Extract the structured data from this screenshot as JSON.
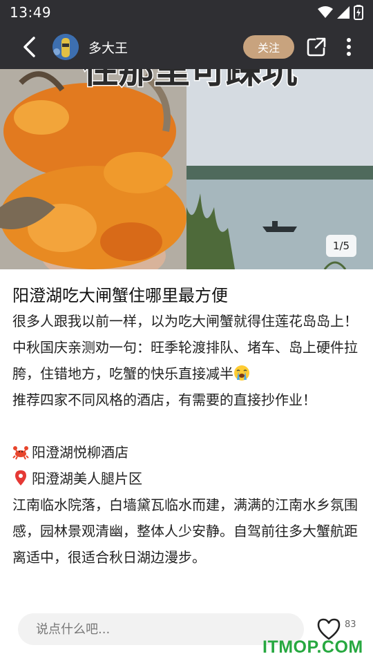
{
  "status_bar": {
    "time": "13:49"
  },
  "header": {
    "author_name": "多大王",
    "follow_label": "关注"
  },
  "carousel": {
    "image_title_text": "住那里可踩坑",
    "counter": "1/5"
  },
  "post": {
    "title": "阳澄湖吃大闸蟹住哪里最方便",
    "paragraphs": [
      "很多人跟我以前一样，以为吃大闸蟹就得住莲花岛岛上！",
      "中秋国庆亲测劝一句：旺季轮渡排队、堵车、岛上硬件拉胯，住错地方，吃蟹的快乐直接减半",
      "推荐四家不同风格的酒店，有需要的直接抄作业！",
      "阳澄湖悦柳酒店",
      "阳澄湖美人腿片区",
      "江南临水院落，白墙黛瓦临水而建，满满的江南水乡氛围感，园林景观清幽，整体人少安静。自驾前往多大蟹航距离适中，很适合秋日湖边漫步。"
    ],
    "icons": {
      "crying": "crying-emoji-icon",
      "crab": "crab-emoji-icon",
      "pin": "location-pin-icon"
    }
  },
  "bottom_bar": {
    "comment_placeholder": "说点什么吧...",
    "like_count": "83",
    "watermark": "ITMOP.COM"
  },
  "colors": {
    "header_bg": "#2f2f33",
    "follow_bg": "#c8a37e",
    "watermark": "#27a840"
  }
}
